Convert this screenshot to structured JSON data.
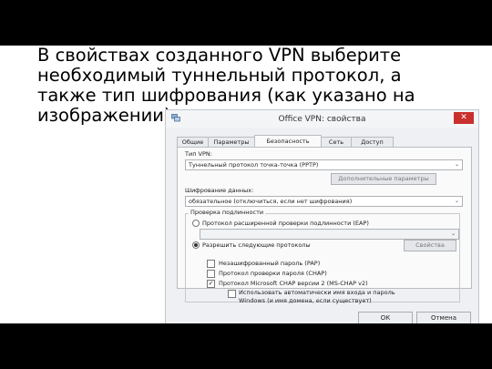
{
  "slide": {
    "caption_lines": [
      "В свойствах созданного VPN выберите",
      "необходимый туннельный протокол, а",
      "также тип шифрования (как указано на",
      "изображении)"
    ]
  },
  "dialog": {
    "title": "Office VPN: свойства",
    "close_label": "✕",
    "tabs": [
      "Общие",
      "Параметры",
      "Безопасность",
      "Сеть",
      "Доступ"
    ],
    "active_tab": "Безопасность",
    "vpn_type_label": "Тип VPN:",
    "vpn_type_value": "Туннельный протокол точка-точка (PPTP)",
    "advanced_button": "Дополнительные параметры",
    "encryption_label": "Шифрование данных:",
    "encryption_value": "обязательное (отключиться, если нет шифрования)",
    "auth_group_label": "Проверка подлинности",
    "eap_radio_label": "Протокол расширенной проверки подлинности (EAP)",
    "allow_radio_label": "Разрешить следующие протоколы",
    "properties_button": "Свойства",
    "protocols": [
      {
        "label": "Незашифрованный пароль (PAP)",
        "checked": false
      },
      {
        "label": "Протокол проверки пароля (CHAP)",
        "checked": false
      },
      {
        "label": "Протокол Microsoft CHAP версии 2 (MS-CHAP v2)",
        "checked": true
      }
    ],
    "auto_logon_line1": "Использовать автоматически имя входа и пароль",
    "auto_logon_line2": "Windows (и имя домена, если существует)",
    "ok_button": "ОК",
    "cancel_button": "Отмена",
    "check_mark": "✓",
    "dropdown_arrow": "⌄",
    "colors": {
      "close_button": "#c9302c",
      "panel_bg": "#fafafa",
      "window_bg": "#eef0f3"
    }
  }
}
